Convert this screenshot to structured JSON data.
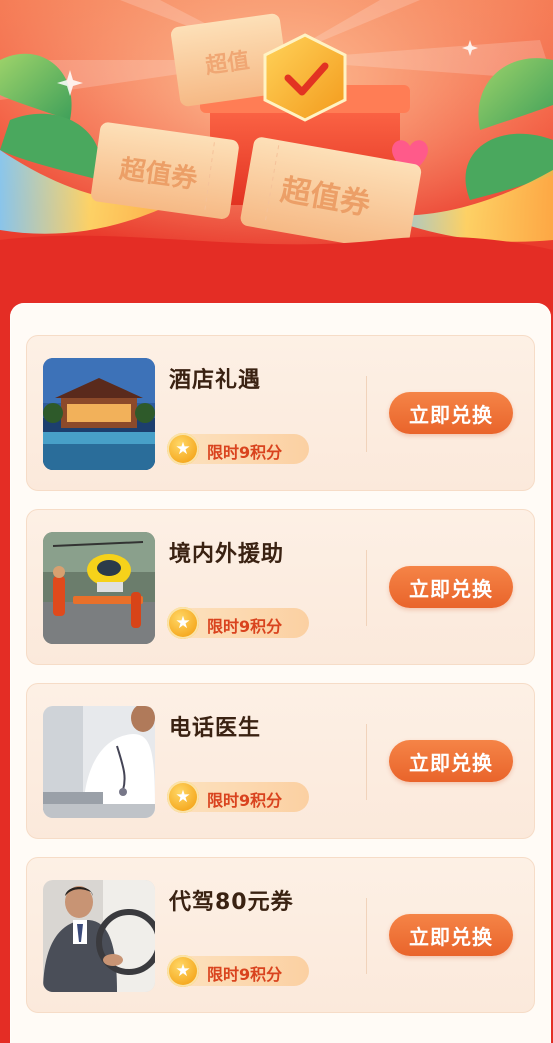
{
  "banner": {
    "ticket_text_left": "超值券",
    "ticket_text_right": "超值券",
    "ticket_text_back": "超值",
    "colors": {
      "top": "#f57a54",
      "bottom": "#e63127"
    }
  },
  "items": [
    {
      "title": "酒店礼遇",
      "badge": "限时9积分",
      "button": "立即兑换",
      "image": "hotel-photo"
    },
    {
      "title": "境内外援助",
      "badge": "限时9积分",
      "button": "立即兑换",
      "image": "helicopter-rescue-photo"
    },
    {
      "title": "电话医生",
      "badge": "限时9积分",
      "button": "立即兑换",
      "image": "doctor-photo"
    },
    {
      "title": "代驾80元券",
      "badge": "限时9积分",
      "button": "立即兑换",
      "image": "driver-photo"
    }
  ],
  "colors": {
    "page_background": "#e42d25",
    "button": "#e9642b",
    "badge_text": "#d9431e",
    "title_text": "#3a2212"
  },
  "icons": {
    "badge_coin": "star-coin-icon"
  }
}
